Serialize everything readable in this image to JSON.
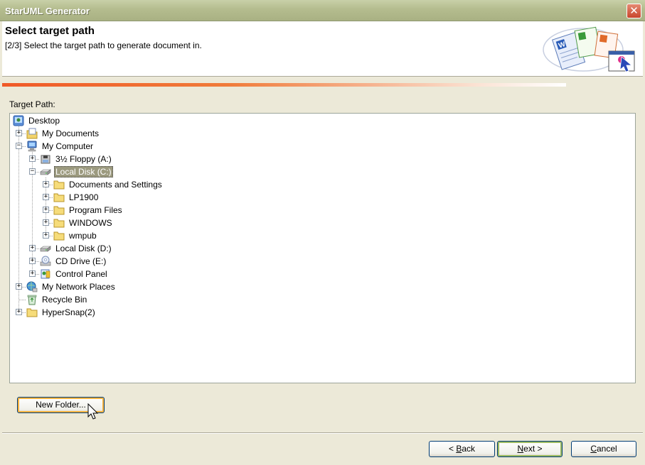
{
  "window": {
    "title": "StarUML Generator",
    "close_glyph": "✕"
  },
  "header": {
    "title": "Select target path",
    "subtitle": "[2/3] Select the target path to generate document in."
  },
  "progress": {
    "fraction": 0.88
  },
  "target_path_label": "Target Path:",
  "tree": {
    "nodes": [
      {
        "label": "Desktop",
        "icon": "desktop-icon",
        "expander": ""
      },
      {
        "label": "My Documents",
        "icon": "my-documents-icon",
        "expander": "+"
      },
      {
        "label": "My Computer",
        "icon": "my-computer-icon",
        "expander": "−"
      },
      {
        "label": "3½ Floppy (A:)",
        "icon": "floppy-icon",
        "expander": "+"
      },
      {
        "label": "Local Disk (C:)",
        "icon": "hard-disk-icon",
        "expander": "−",
        "selected": true
      },
      {
        "label": "Documents and Settings",
        "icon": "folder-icon",
        "expander": "+"
      },
      {
        "label": "LP1900",
        "icon": "folder-icon",
        "expander": "+"
      },
      {
        "label": "Program Files",
        "icon": "folder-icon",
        "expander": "+"
      },
      {
        "label": "WINDOWS",
        "icon": "folder-icon",
        "expander": "+"
      },
      {
        "label": "wmpub",
        "icon": "folder-icon",
        "expander": "+"
      },
      {
        "label": "Local Disk (D:)",
        "icon": "hard-disk-icon",
        "expander": "+"
      },
      {
        "label": "CD Drive (E:)",
        "icon": "cd-drive-icon",
        "expander": "+"
      },
      {
        "label": "Control Panel",
        "icon": "control-panel-icon",
        "expander": "+"
      },
      {
        "label": "My Network Places",
        "icon": "network-places-icon",
        "expander": "+"
      },
      {
        "label": "Recycle Bin",
        "icon": "recycle-bin-icon",
        "expander": ""
      },
      {
        "label": "HyperSnap(2)",
        "icon": "folder-icon",
        "expander": "+"
      }
    ]
  },
  "buttons": {
    "new_folder": "New Folder...",
    "back_prefix": "< ",
    "back_key": "B",
    "back_rest": "ack",
    "next_key": "N",
    "next_rest": "ext >",
    "cancel_key": "C",
    "cancel_rest": "ancel"
  }
}
